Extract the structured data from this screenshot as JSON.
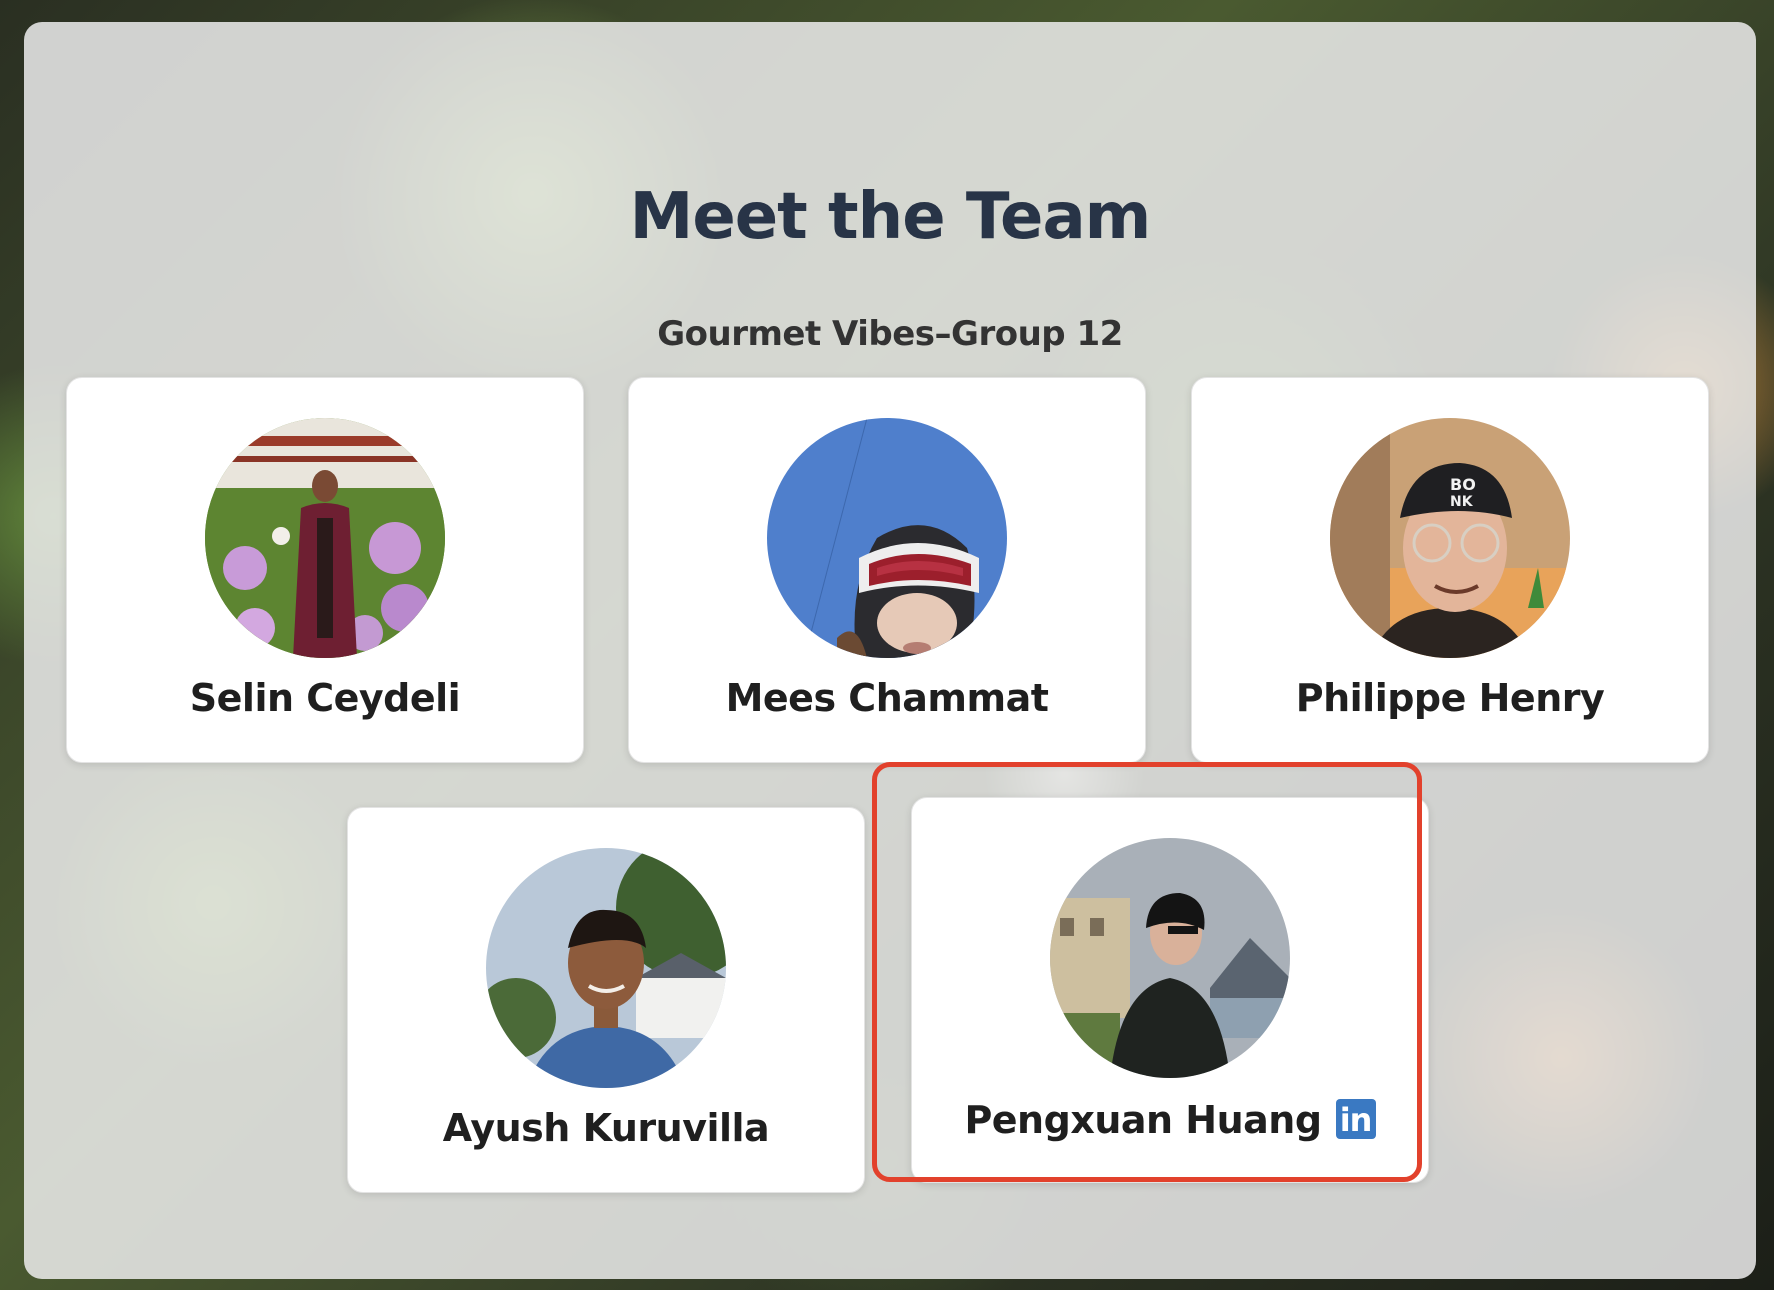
{
  "page": {
    "title": "Meet the Team",
    "subtitle": "Gourmet Vibes–Group 12"
  },
  "team": [
    {
      "name": "Selin Ceydeli",
      "photo": "graduation-photo"
    },
    {
      "name": "Mees Chammat",
      "photo": "ski-goggles-selfie"
    },
    {
      "name": "Philippe Henry",
      "photo": "cap-selfie"
    },
    {
      "name": "Ayush Kuruvilla",
      "photo": "outdoor-portrait"
    },
    {
      "name": "Pengxuan Huang",
      "photo": "city-river-portrait",
      "linkedin_label": "in"
    }
  ],
  "colors": {
    "title": "#283447",
    "highlight_border": "#e2412c",
    "linkedin": "#3a79c2",
    "panel": "rgba(236,236,236,0.86)"
  }
}
